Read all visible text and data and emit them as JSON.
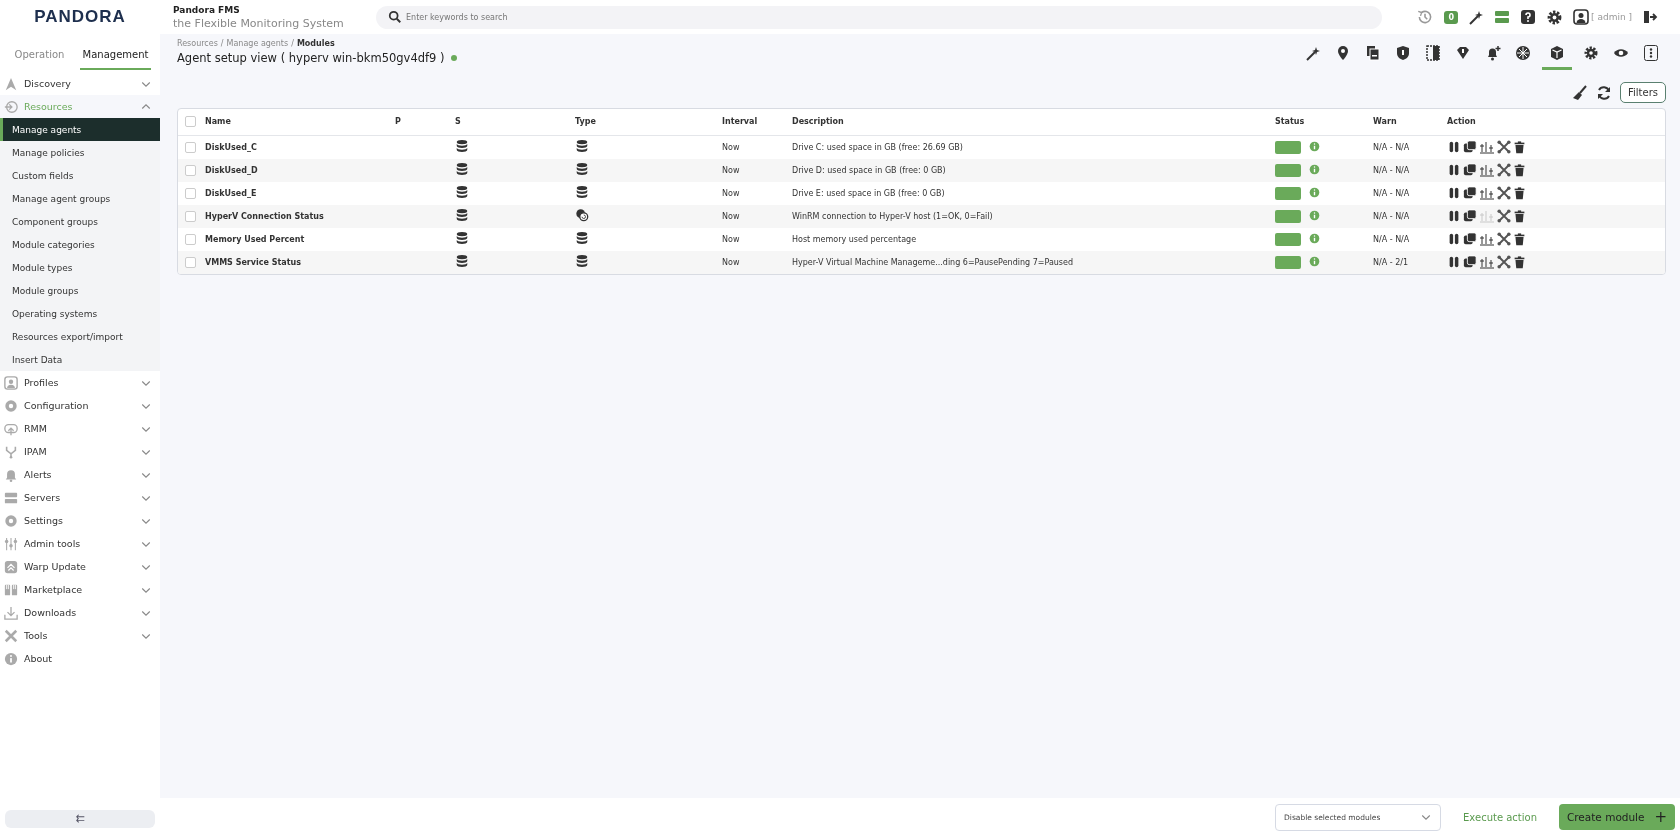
{
  "header": {
    "product": "Pandora FMS",
    "tagline": "the Flexible Monitoring System",
    "logo": "PANDORA",
    "search": {
      "placeholder": "Enter keywords to search"
    },
    "badge": "0",
    "user": "[ admin ]"
  },
  "sidebar": {
    "tabs": [
      {
        "label": "Operation",
        "selected": false
      },
      {
        "label": "Management",
        "selected": true
      }
    ],
    "items": [
      {
        "label": "Discovery",
        "expanded": false,
        "selected": false
      },
      {
        "label": "Resources",
        "expanded": true,
        "selected": true,
        "children": [
          {
            "label": "Manage agents",
            "selected": true
          },
          {
            "label": "Manage policies",
            "selected": false
          },
          {
            "label": "Custom fields",
            "selected": false
          },
          {
            "label": "Manage agent groups",
            "selected": false
          },
          {
            "label": "Component groups",
            "selected": false
          },
          {
            "label": "Module categories",
            "selected": false
          },
          {
            "label": "Module types",
            "selected": false
          },
          {
            "label": "Module groups",
            "selected": false
          },
          {
            "label": "Operating systems",
            "selected": false
          },
          {
            "label": "Resources export/import",
            "selected": false
          },
          {
            "label": "Insert Data",
            "selected": false
          }
        ]
      },
      {
        "label": "Profiles",
        "expanded": false,
        "selected": false
      },
      {
        "label": "Configuration",
        "expanded": false,
        "selected": false
      },
      {
        "label": "RMM",
        "expanded": false,
        "selected": false
      },
      {
        "label": "IPAM",
        "expanded": false,
        "selected": false
      },
      {
        "label": "Alerts",
        "expanded": false,
        "selected": false
      },
      {
        "label": "Servers",
        "expanded": false,
        "selected": false
      },
      {
        "label": "Settings",
        "expanded": false,
        "selected": false
      },
      {
        "label": "Admin tools",
        "expanded": false,
        "selected": false
      },
      {
        "label": "Warp Update",
        "expanded": false,
        "selected": false
      },
      {
        "label": "Marketplace",
        "expanded": false,
        "selected": false
      },
      {
        "label": "Downloads",
        "expanded": false,
        "selected": false
      },
      {
        "label": "Tools",
        "expanded": false,
        "selected": false
      },
      {
        "label": "About",
        "selected": false
      }
    ],
    "collapse": "⇇"
  },
  "page": {
    "breadcrumb": [
      "Resources",
      "/",
      "Manage agents",
      "/",
      "Modules"
    ],
    "title": "Agent setup view ( hyperv win-bkm50gv4df9 )",
    "tabs": [
      {
        "kind": "wand",
        "selected": false
      },
      {
        "kind": "pin",
        "selected": false
      },
      {
        "kind": "copy",
        "selected": false
      },
      {
        "kind": "shield",
        "selected": false
      },
      {
        "kind": "panel",
        "selected": false
      },
      {
        "kind": "diamond",
        "selected": false
      },
      {
        "kind": "bellplus",
        "selected": false
      },
      {
        "kind": "flake",
        "selected": false
      },
      {
        "kind": "cube",
        "selected": true
      },
      {
        "kind": "gear",
        "selected": false
      },
      {
        "kind": "eye",
        "selected": false
      },
      {
        "kind": "more",
        "selected": false
      }
    ],
    "filters": "Filters"
  },
  "table": {
    "select_all_checked": false,
    "columns": [
      "Name",
      "P",
      "S",
      "Type",
      "Interval",
      "Description",
      "Status",
      "Warn",
      "Action"
    ],
    "rows": [
      {
        "name": "DiskUsed_C",
        "kind": "data",
        "interval": "Now",
        "description": "Drive C: used space in GB (free: 26.69 GB)",
        "warn": "N/A - N/A",
        "checked": false,
        "graph_enabled": true
      },
      {
        "name": "DiskUsed_D",
        "kind": "data",
        "interval": "Now",
        "description": "Drive D: used space in GB (free: 0 GB)",
        "warn": "N/A - N/A",
        "checked": false,
        "graph_enabled": true
      },
      {
        "name": "DiskUsed_E",
        "kind": "data",
        "interval": "Now",
        "description": "Drive E: used space in GB (free: 0 GB)",
        "warn": "N/A - N/A",
        "checked": false,
        "graph_enabled": true
      },
      {
        "name": "HyperV Connection Status",
        "kind": "proc",
        "interval": "Now",
        "description": "WinRM connection to Hyper-V host (1=OK, 0=Fail)",
        "warn": "N/A - N/A",
        "checked": false,
        "graph_enabled": false
      },
      {
        "name": "Memory Used Percent",
        "kind": "data",
        "interval": "Now",
        "description": "Host memory used percentage",
        "warn": "N/A - N/A",
        "checked": false,
        "graph_enabled": true
      },
      {
        "name": "VMMS Service Status",
        "kind": "data",
        "interval": "Now",
        "description": "Hyper-V Virtual Machine Manageme...ding 6=PausePending 7=Paused",
        "warn": "N/A - 2/1",
        "checked": false,
        "graph_enabled": true
      }
    ]
  },
  "footer": {
    "action_select": "Disable selected modules",
    "execute": "Execute action",
    "create": "Create module",
    "create_icon": "+"
  }
}
